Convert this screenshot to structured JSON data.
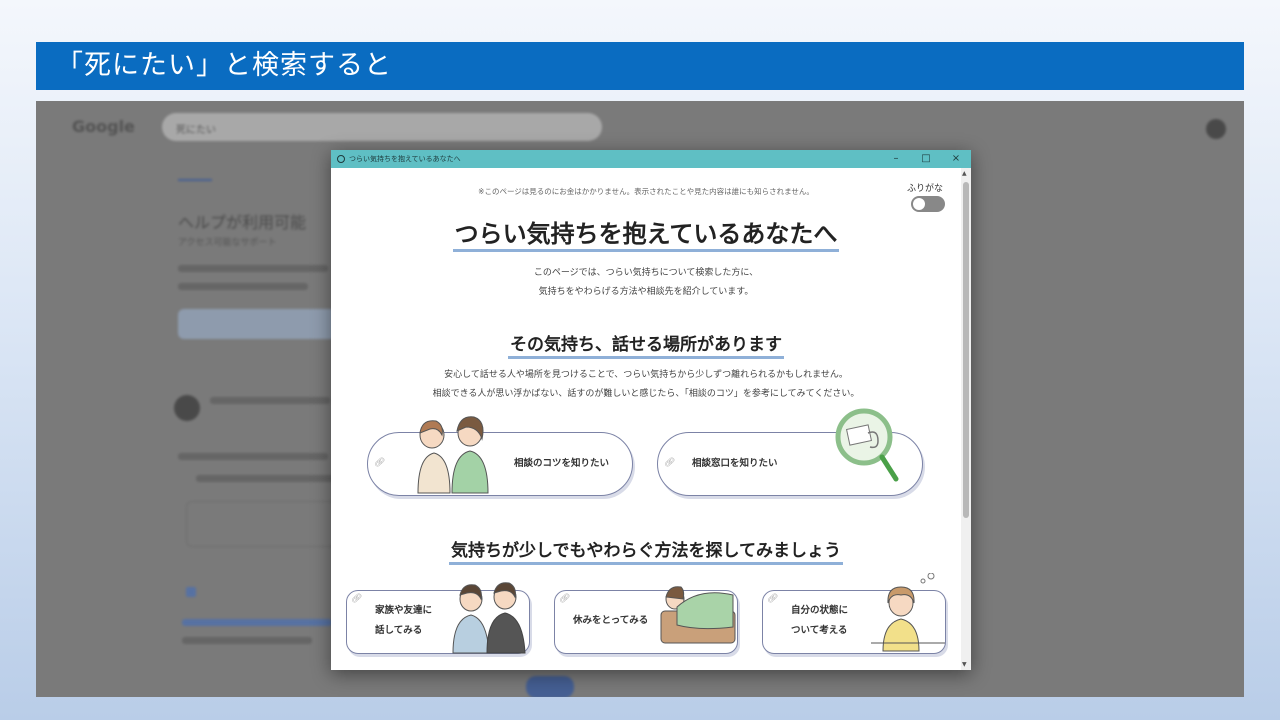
{
  "slide": {
    "title": "「死にたい」と検索すると"
  },
  "background": {
    "logo": "Google",
    "search_text": "死にたい",
    "headline": "ヘルプが利用可能",
    "subline": "アクセス可能なサポート",
    "colors": {
      "search_bar": "#cfcfcf",
      "accent": "#1a4aa8"
    }
  },
  "window": {
    "title": "つらい気持ちを抱えているあなたへ",
    "controls": {
      "minimize": "–",
      "maximize": "□",
      "close": "×"
    },
    "notice": "※このページは見るのにお金はかかりません。表示されたことや見た内容は誰にも知らされません。",
    "furigana_label": "ふりがな",
    "furigana_on": false,
    "heading": "つらい気持ちを抱えているあなたへ",
    "intro_lines": [
      "このページでは、つらい気持ちについて検索した方に、",
      "気持ちをやわらげる方法や相談先を紹介しています。"
    ],
    "section1": {
      "heading": "その気持ち、話せる場所があります",
      "desc_lines": [
        "安心して話せる人や場所を見つけることで、つらい気持ちから少しずつ離れられるかもしれません。",
        "相談できる人が思い浮かばない、話すのが難しいと感じたら、「相談のコツ」を参考にしてみてください。"
      ],
      "buttons": [
        {
          "label": "相談のコツを知りたい",
          "icon": "link-icon"
        },
        {
          "label": "相談窓口を知りたい",
          "icon": "link-icon"
        }
      ]
    },
    "section2": {
      "heading": "気持ちが少しでもやわらぐ方法を探してみましょう",
      "cards": [
        {
          "label_lines": [
            "家族や友達に",
            "話してみる"
          ]
        },
        {
          "label_lines": [
            "休みをとってみる"
          ]
        },
        {
          "label_lines": [
            "自分の状態に",
            "ついて考える"
          ]
        }
      ]
    },
    "colors": {
      "titlebar": "#5fbfc4",
      "underline": "#8fb0d8",
      "border": "#7c83a6"
    }
  }
}
